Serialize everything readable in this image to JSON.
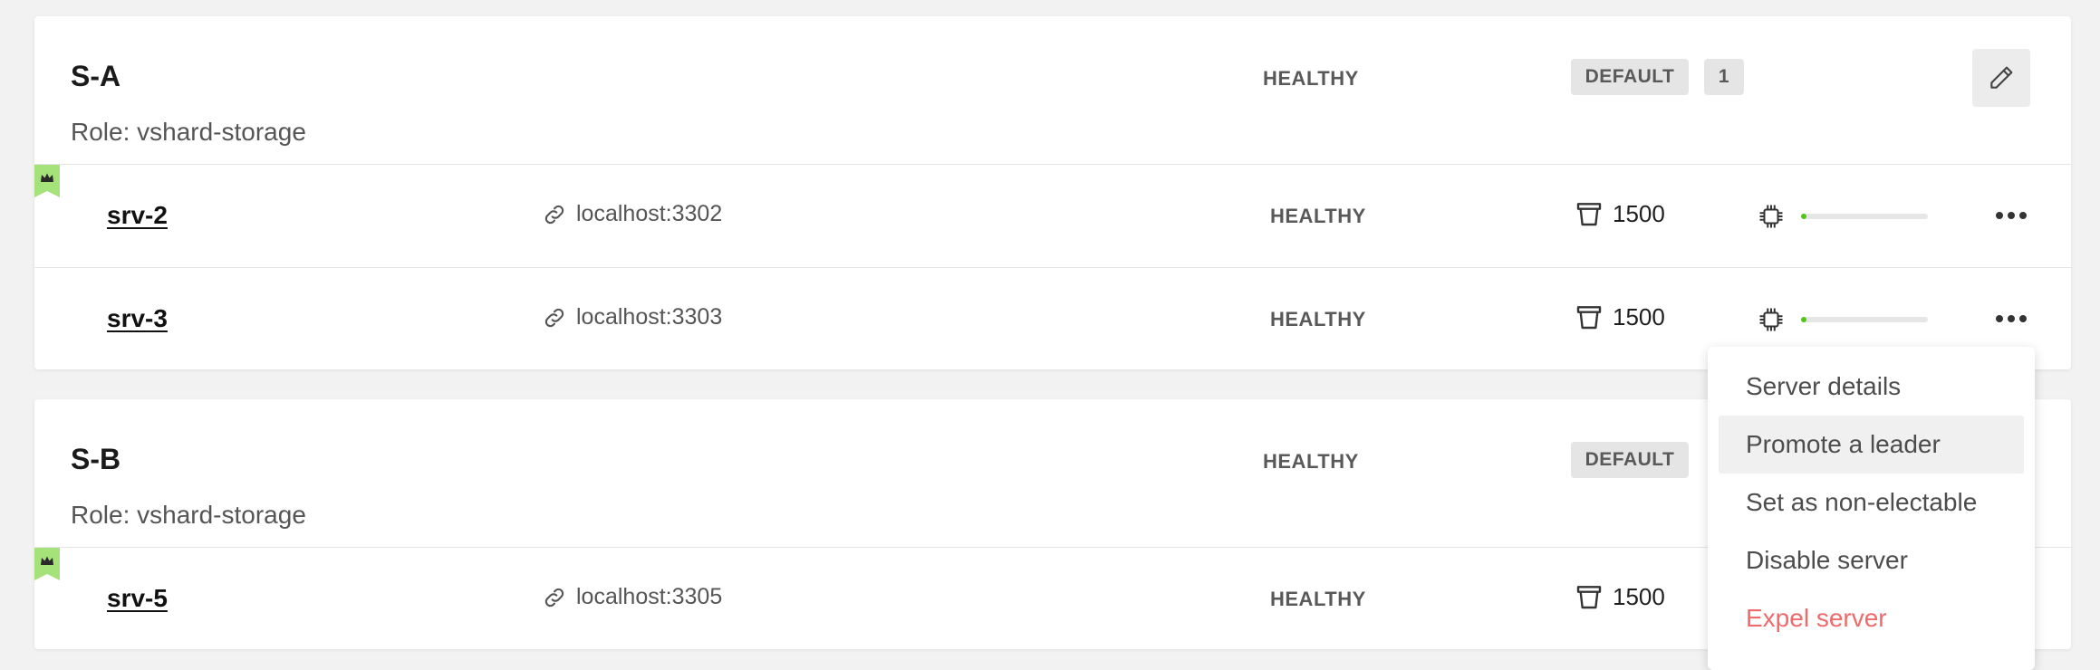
{
  "replicasets": [
    {
      "name": "S-A",
      "role": "Role: vshard-storage",
      "health": "HEALTHY",
      "tag": "DEFAULT",
      "weight": "1",
      "servers": [
        {
          "alias": "srv-2",
          "uri": "localhost:3302",
          "health": "HEALTHY",
          "buckets": "1500",
          "leader": true,
          "memory_fraction": 0.04
        },
        {
          "alias": "srv-3",
          "uri": "localhost:3303",
          "health": "HEALTHY",
          "buckets": "1500",
          "leader": false,
          "memory_fraction": 0.04
        }
      ]
    },
    {
      "name": "S-B",
      "role": "Role: vshard-storage",
      "health": "HEALTHY",
      "tag": "DEFAULT",
      "servers": [
        {
          "alias": "srv-5",
          "uri": "localhost:3305",
          "health": "HEALTHY",
          "buckets": "1500",
          "leader": true
        }
      ]
    }
  ],
  "dropdown": {
    "items": [
      {
        "label": "Server details"
      },
      {
        "label": "Promote a leader",
        "active": true
      },
      {
        "label": "Set as non-electable"
      },
      {
        "label": "Disable server"
      },
      {
        "label": "Expel server",
        "danger": true
      }
    ]
  },
  "colors": {
    "leader_flag": "#a6e27a",
    "memory_fill": "#52c41a",
    "danger": "#ef6b6b"
  },
  "icons": {
    "edit": "pencil-icon",
    "uri": "link-icon",
    "buckets": "bucket-icon",
    "memory": "chip-icon",
    "menu": "more-dots-icon",
    "leader": "crown-icon"
  }
}
